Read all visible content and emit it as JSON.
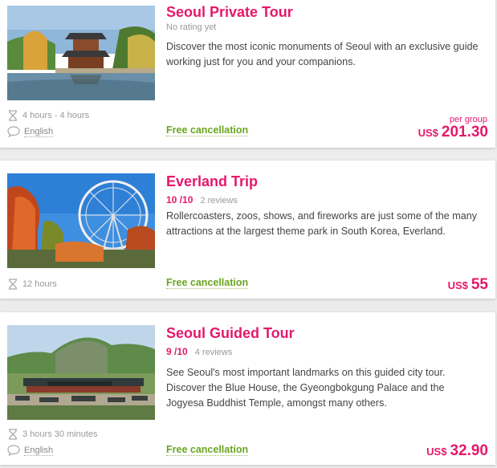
{
  "tours": [
    {
      "title": "Seoul Private Tour",
      "rating_text": "No rating yet",
      "description": "Discover the most iconic monuments of Seoul with an exclusive guide working just for you and your companions.",
      "duration": "4 hours - 4 hours",
      "language": "English",
      "cancellation": "Free cancellation",
      "price_note": "per group",
      "currency": "US$",
      "price": "201.30",
      "image_icon": "palace-pavilion-photo"
    },
    {
      "title": "Everland Trip",
      "score": "10 /10",
      "reviews": "2 reviews",
      "description": "Rollercoasters, zoos, shows, and fireworks are just some of the many attractions at the largest theme park in South Korea, Everland.",
      "duration": "12 hours",
      "cancellation": "Free cancellation",
      "currency": "US$",
      "price": "55",
      "image_icon": "ferris-wheel-photo"
    },
    {
      "title": "Seoul Guided Tour",
      "score": "9 /10",
      "reviews": "4 reviews",
      "description": "See Seoul's most important landmarks on this guided city tour. Discover the Blue House, the Gyeongbokgung Palace and the Jogyesa Buddhist Temple, amongst many others.",
      "duration": "3 hours 30 minutes",
      "language": "English",
      "cancellation": "Free cancellation",
      "currency": "US$",
      "price": "32.90",
      "image_icon": "palace-mountain-photo"
    }
  ],
  "colors": {
    "accent": "#e5186b",
    "green": "#6aa521",
    "muted": "#999999",
    "text": "#444444"
  }
}
